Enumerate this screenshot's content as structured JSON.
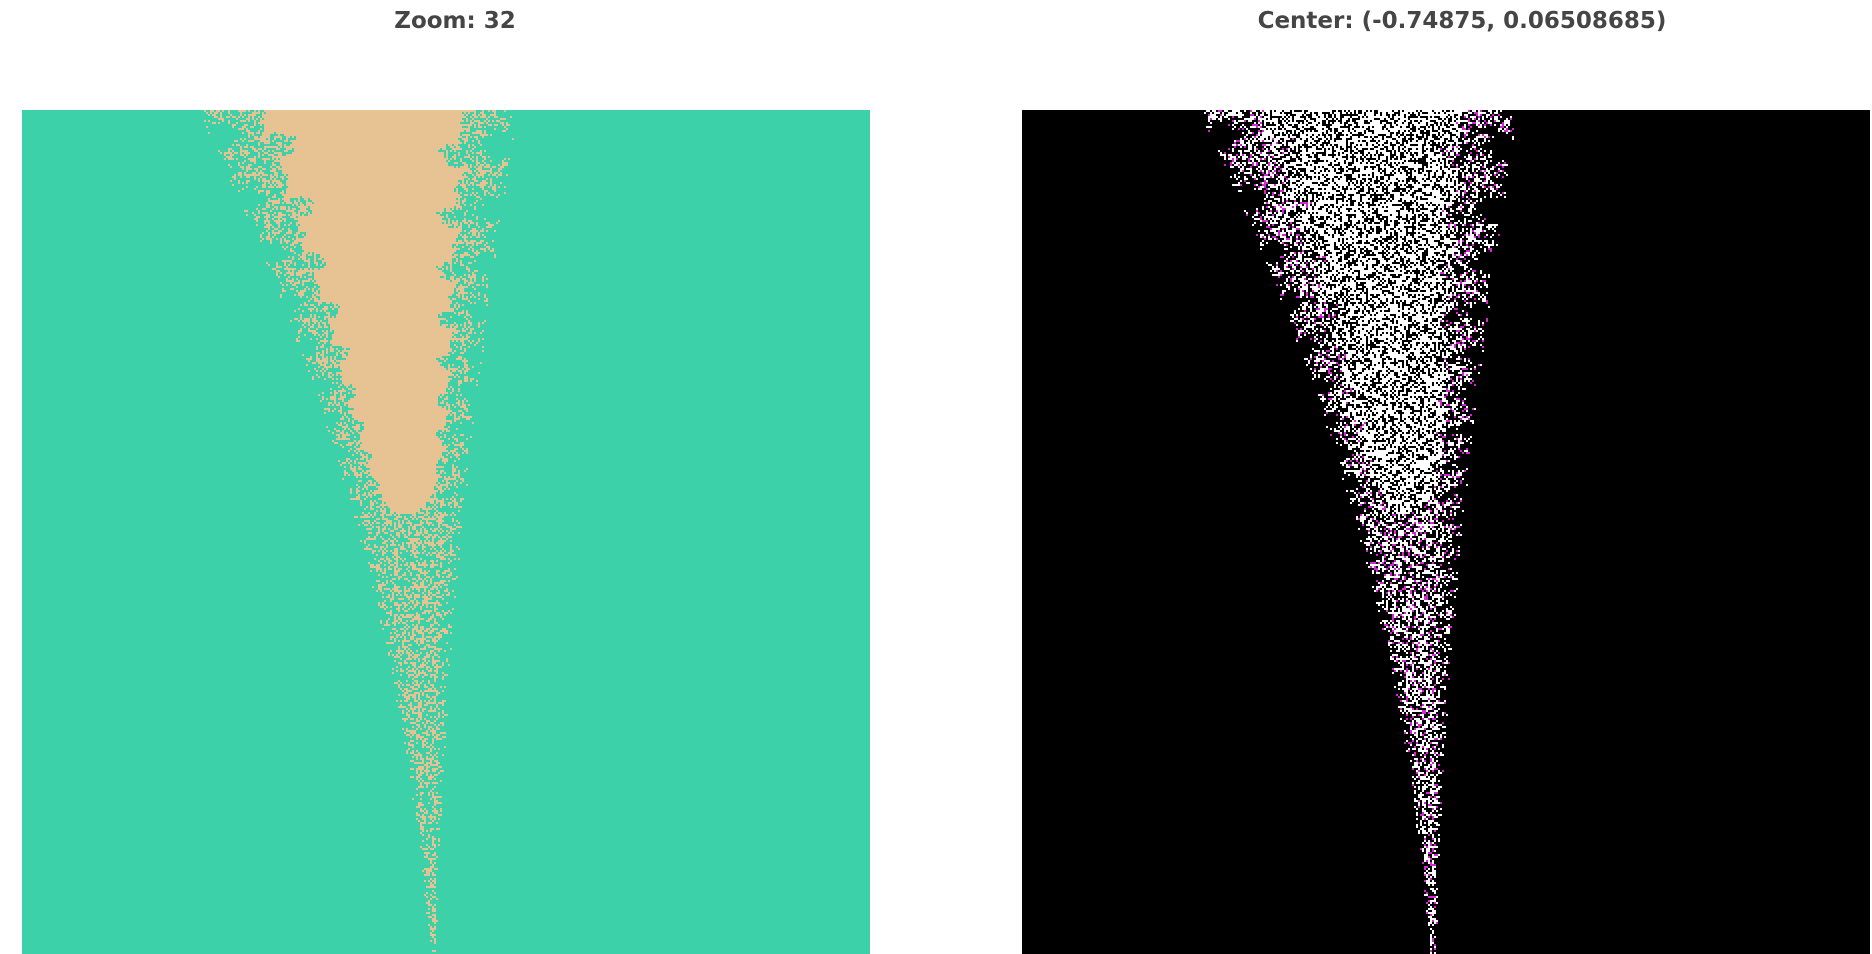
{
  "left_panel": {
    "caption": "Zoom: 32",
    "colors": {
      "background": "#d6bb7f",
      "filament": "#e7c393",
      "dot": "#3cd1a9"
    }
  },
  "right_panel": {
    "caption": "Center: (-0.74875, 0.06508685)",
    "colors": {
      "background": "#000000",
      "filament": "#ffffff",
      "accent": "#d22ad2"
    }
  }
}
